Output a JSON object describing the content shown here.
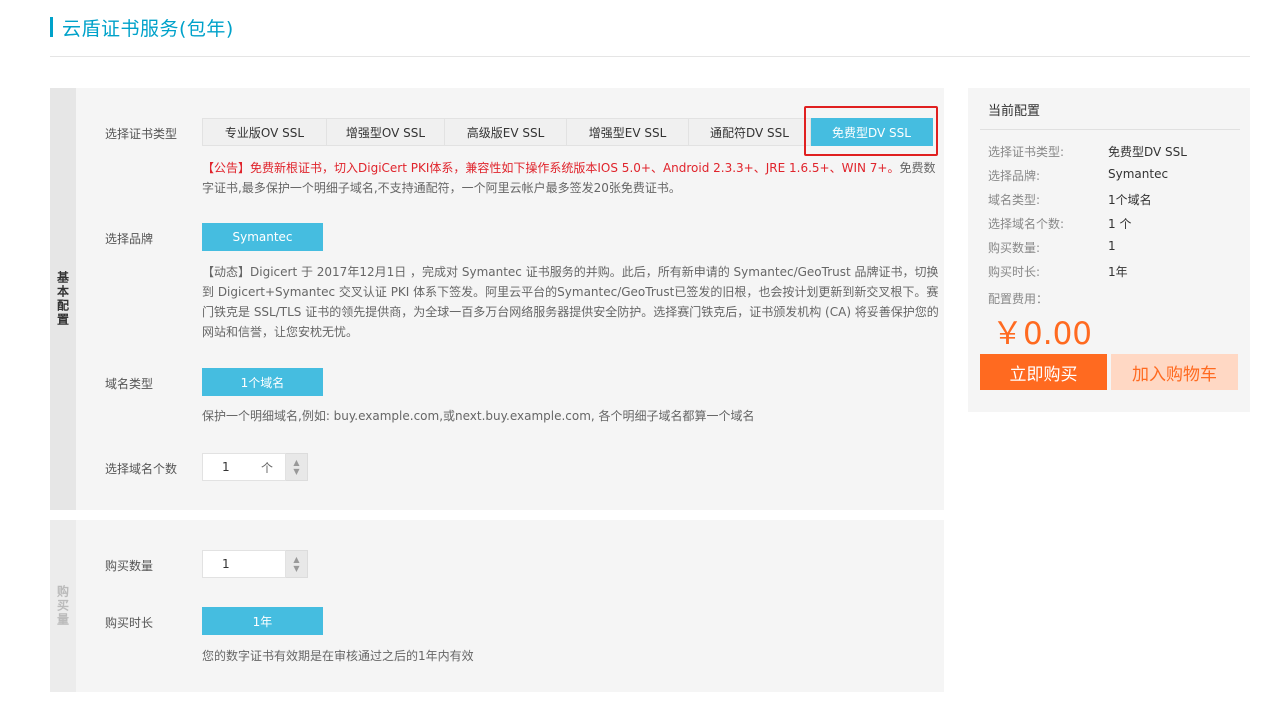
{
  "page": {
    "title": "云盾证书服务(包年)"
  },
  "basic_section": {
    "tab_label": "基本配置",
    "cert_type": {
      "label": "选择证书类型",
      "options": [
        "专业版OV SSL",
        "增强型OV SSL",
        "高级版EV SSL",
        "增强型EV SSL",
        "通配符DV SSL",
        "免费型DV SSL"
      ],
      "selected": "免费型DV SSL"
    },
    "notice_red": "【公告】免费新根证书，切入DigiCert PKI体系，兼容性如下操作系统版本IOS 5.0+、Android 2.3.3+、JRE 1.6.5+、WIN 7+。",
    "notice_gray": "免费数字证书,最多保护一个明细子域名,不支持通配符，一个阿里云帐户最多签发20张免费证书。",
    "brand": {
      "label": "选择品牌",
      "selected": "Symantec",
      "desc": "【动态】Digicert 于 2017年12月1日 ，完成对 Symantec 证书服务的并购。此后，所有新申请的 Symantec/GeoTrust 品牌证书，切换到 Digicert+Symantec 交叉认证 PKI 体系下签发。阿里云平台的Symantec/GeoTrust已签发的旧根，也会按计划更新到新交叉根下。赛门铁克是 SSL/TLS 证书的领先提供商，为全球一百多万台网络服务器提供安全防护。选择赛门铁克后，证书颁发机构 (CA) 将妥善保护您的网站和信誉，让您安枕无忧。"
    },
    "domain_type": {
      "label": "域名类型",
      "selected": "1个域名",
      "desc": "保护一个明细域名,例如: buy.example.com,或next.buy.example.com, 各个明细子域名都算一个域名"
    },
    "domain_count": {
      "label": "选择域名个数",
      "value": "1",
      "unit": "个"
    }
  },
  "buy_section": {
    "tab_label": "购买量",
    "quantity": {
      "label": "购买数量",
      "value": "1"
    },
    "duration": {
      "label": "购买时长",
      "selected": "1年",
      "desc": "您的数字证书有效期是在审核通过之后的1年内有效"
    }
  },
  "summary": {
    "title": "当前配置",
    "rows": [
      {
        "key": "选择证书类型:",
        "value": "免费型DV SSL"
      },
      {
        "key": "选择品牌:",
        "value": "Symantec"
      },
      {
        "key": "域名类型:",
        "value": "1个域名"
      },
      {
        "key": "选择域名个数:",
        "value": "1 个"
      },
      {
        "key": "购买数量:",
        "value": "1"
      },
      {
        "key": "购买时长:",
        "value": "1年"
      }
    ],
    "fee_label": "配置费用：",
    "price": "￥0.00",
    "buy_now": "立即购买",
    "add_to_cart": "加入购物车"
  },
  "colors": {
    "accent": "#45bde0",
    "title": "#00a2ca",
    "orange": "#ff6a20",
    "red": "#e0242c",
    "highlight": "#e02020"
  }
}
